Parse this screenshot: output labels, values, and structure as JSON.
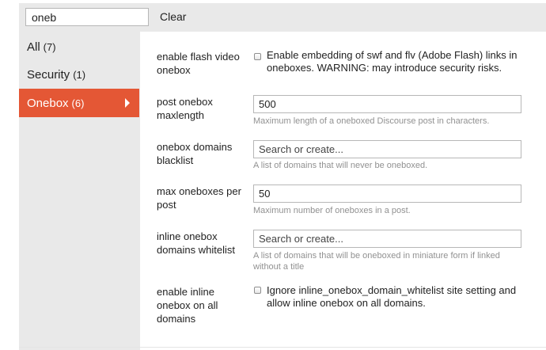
{
  "filter": {
    "value": "oneb",
    "clear_label": "Clear"
  },
  "sidebar": {
    "items": [
      {
        "label": "All",
        "count": "(7)"
      },
      {
        "label": "Security",
        "count": "(1)"
      },
      {
        "label": "Onebox",
        "count": "(6)",
        "active": true
      }
    ]
  },
  "colors": {
    "accent": "#e45735",
    "sidebar_bg": "#e9e9e9",
    "description_text": "#919191"
  },
  "settings": [
    {
      "label": "enable flash video onebox",
      "type": "checkbox",
      "checked": false,
      "text": "Enable embedding of swf and flv (Adobe Flash) links in oneboxes. WARNING: may introduce security risks."
    },
    {
      "label": "post onebox maxlength",
      "type": "text",
      "value": "500",
      "description": "Maximum length of a oneboxed Discourse post in characters."
    },
    {
      "label": "onebox domains blacklist",
      "type": "list",
      "placeholder": "Search or create...",
      "description": "A list of domains that will never be oneboxed."
    },
    {
      "label": "max oneboxes per post",
      "type": "text",
      "value": "50",
      "description": "Maximum number of oneboxes in a post."
    },
    {
      "label": "inline onebox domains whitelist",
      "type": "list",
      "placeholder": "Search or create...",
      "description": "A list of domains that will be oneboxed in miniature form if linked without a title"
    },
    {
      "label": "enable inline onebox on all domains",
      "type": "checkbox",
      "checked": false,
      "text": "Ignore inline_onebox_domain_whitelist site setting and allow inline onebox on all domains."
    }
  ]
}
